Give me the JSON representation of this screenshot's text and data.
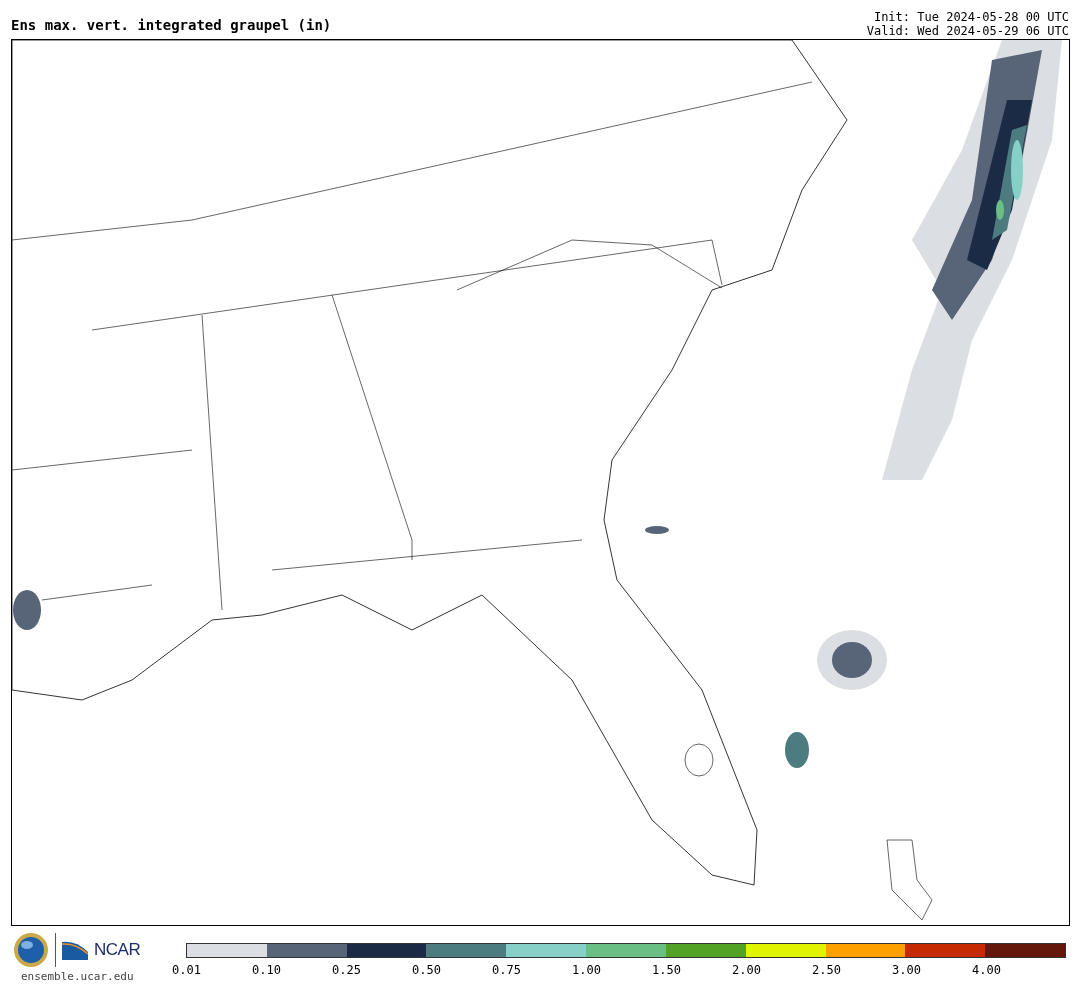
{
  "title": "Ens max. vert. integrated graupel (in)",
  "times": [
    "Init: Tue 2024-05-28 00 UTC",
    "Valid: Wed 2024-05-29 06 UTC"
  ],
  "logos": {
    "ncar": "NCAR",
    "url": "ensemble.ucar.edu"
  },
  "colorbar": [
    {
      "label": "0.01",
      "color": "#dbdfe3"
    },
    {
      "label": "0.10",
      "color": "#586578"
    },
    {
      "label": "0.25",
      "color": "#1c2b45"
    },
    {
      "label": "0.50",
      "color": "#4d7c80"
    },
    {
      "label": "0.75",
      "color": "#86d0c8"
    },
    {
      "label": "1.00",
      "color": "#6ac084"
    },
    {
      "label": "1.50",
      "color": "#52a226"
    },
    {
      "label": "2.00",
      "color": "#e2f300"
    },
    {
      "label": "2.50",
      "color": "#fea000"
    },
    {
      "label": "3.00",
      "color": "#c62a02"
    },
    {
      "label": "4.00",
      "color": "#63180b"
    }
  ]
}
